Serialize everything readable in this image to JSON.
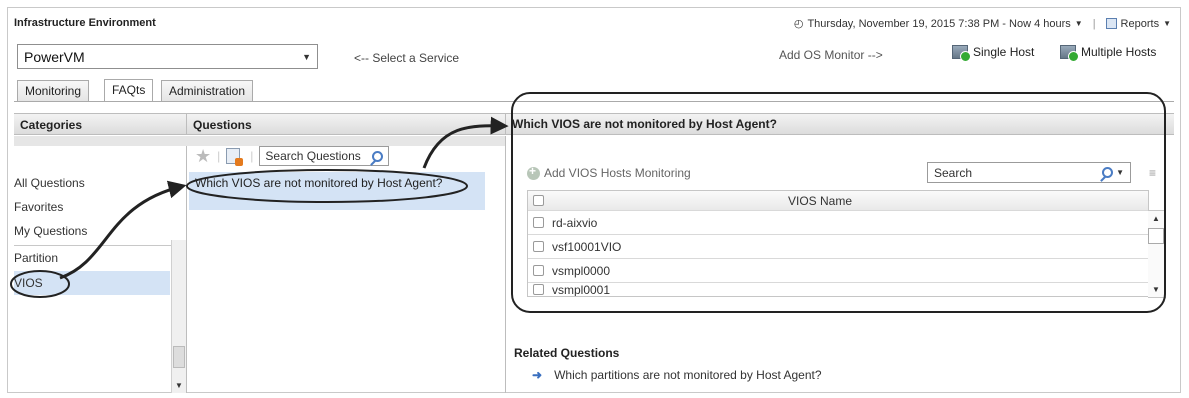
{
  "header": {
    "title": "Infrastructure Environment",
    "datetime": "Thursday, November 19, 2015 7:38 PM - Now 4 hours",
    "reports_label": "Reports"
  },
  "service": {
    "selected": "PowerVM",
    "hint": "<-- Select a Service"
  },
  "monitor": {
    "add_os_label": "Add OS Monitor -->",
    "single_host": "Single Host",
    "multiple_hosts": "Multiple Hosts"
  },
  "tabs": [
    "Monitoring",
    "FAQts",
    "Administration"
  ],
  "categories": {
    "heading": "Categories",
    "items": [
      "All Questions",
      "Favorites",
      "My Questions",
      "Partition",
      "VIOS"
    ]
  },
  "questions": {
    "heading": "Questions",
    "search_placeholder": "Search Questions",
    "items": [
      "Which VIOS are not monitored by Host Agent?"
    ]
  },
  "answer": {
    "title": "Which VIOS are not monitored by Host Agent?",
    "add_button": "Add VIOS Hosts Monitoring",
    "search_placeholder": "Search",
    "column_header": "VIOS Name",
    "rows": [
      "rd-aixvio",
      "vsf10001VIO",
      "vsmpl0000",
      "vsmpl0001"
    ]
  },
  "related": {
    "heading": "Related Questions",
    "items": [
      "Which partitions are not monitored by Host Agent?"
    ]
  }
}
